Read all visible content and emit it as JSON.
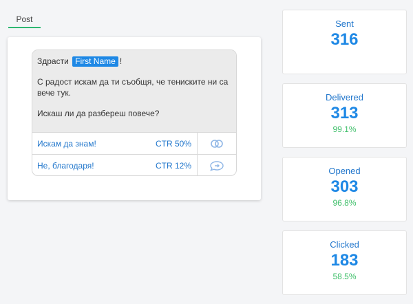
{
  "tab": {
    "label": "Post"
  },
  "message": {
    "greeting": "Здрасти",
    "tag": "First Name",
    "exclaim": "!",
    "body_line1": "С радост искам да ти съобщя, че тениските ни са",
    "body_line2": "вече тук.",
    "question": "Искаш ли да разбереш повече?"
  },
  "buttons": [
    {
      "label": "Искам да знам!",
      "ctr": "CTR 50%",
      "icon": "link-icon"
    },
    {
      "label": "Не, благодаря!",
      "ctr": "CTR 12%",
      "icon": "reply-icon"
    }
  ],
  "stats": {
    "sent": {
      "label": "Sent",
      "value": "316"
    },
    "delivered": {
      "label": "Delivered",
      "value": "313",
      "pct": "99.1%"
    },
    "opened": {
      "label": "Opened",
      "value": "303",
      "pct": "96.8%"
    },
    "clicked": {
      "label": "Clicked",
      "value": "183",
      "pct": "58.5%"
    }
  },
  "colors": {
    "accent": "#1e88e5",
    "success": "#3fbf6a",
    "tab_underline": "#2eb872"
  }
}
